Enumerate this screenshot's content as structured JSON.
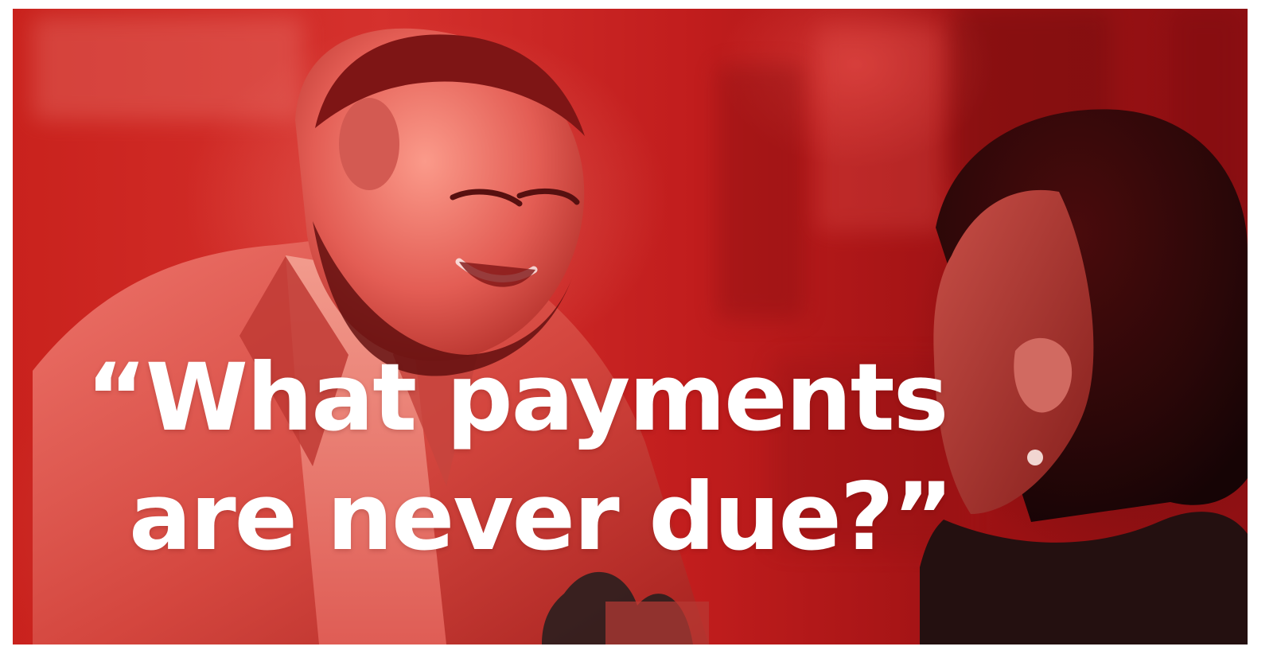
{
  "image": {
    "caption_lines": [
      "“What payments",
      "are never due?”"
    ],
    "colors": {
      "background": "#ffffff",
      "photo_red": "#b9171b",
      "text": "#ffffff"
    }
  }
}
